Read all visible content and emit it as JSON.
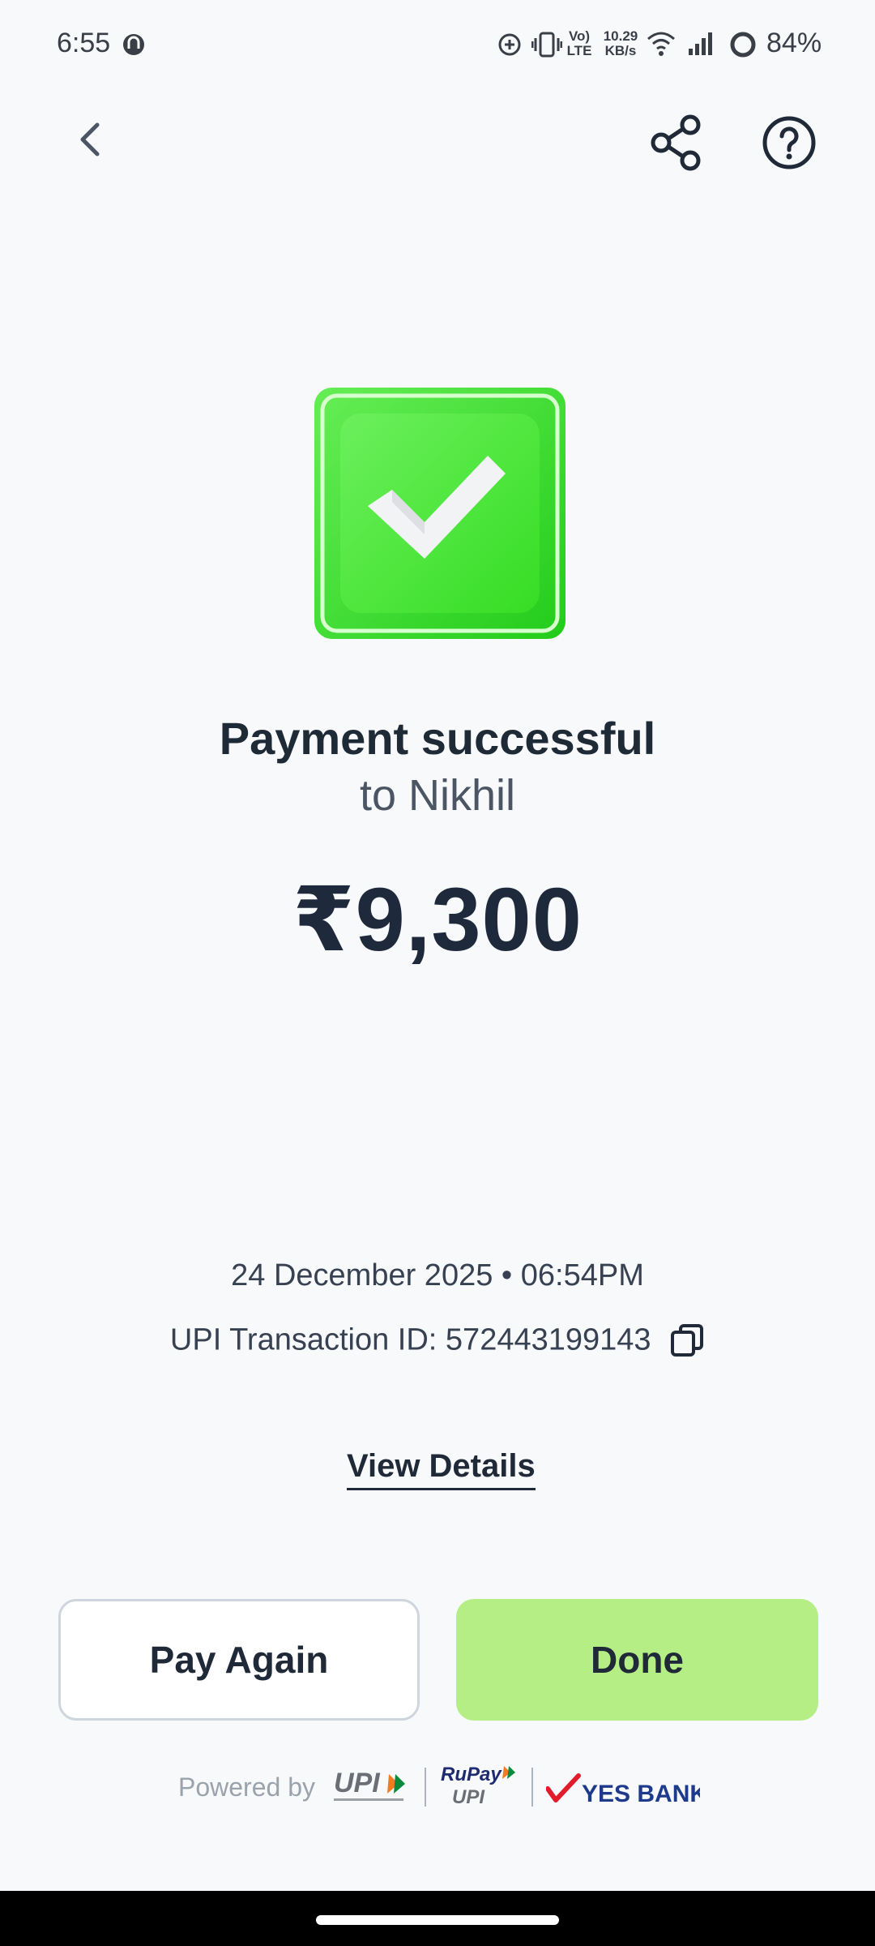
{
  "status_bar": {
    "time": "6:55",
    "network_type": "Vo) LTE",
    "speed_value": "10.29",
    "speed_unit": "KB/s",
    "battery": "84%"
  },
  "nav": {
    "back_icon": "chevron-left-icon",
    "share_icon": "share-icon",
    "help_icon": "help-circle-icon"
  },
  "result": {
    "title": "Payment successful",
    "recipient": "to Nikhil",
    "amount": "₹9,300",
    "datetime": "24 December 2025 • 06:54PM",
    "transaction_label": "UPI Transaction ID: 572443199143",
    "view_details": "View Details"
  },
  "actions": {
    "pay_again": "Pay Again",
    "done": "Done"
  },
  "footer": {
    "powered_by": "Powered by",
    "upi_logo_text": "UPI",
    "rupay_logo_text": "RuPay",
    "bank_name": "YES BANK"
  },
  "colors": {
    "background": "#f7f9fb",
    "success_green": "#3ee02e",
    "done_button": "#b6ee86",
    "text_dark": "#1f2937"
  }
}
